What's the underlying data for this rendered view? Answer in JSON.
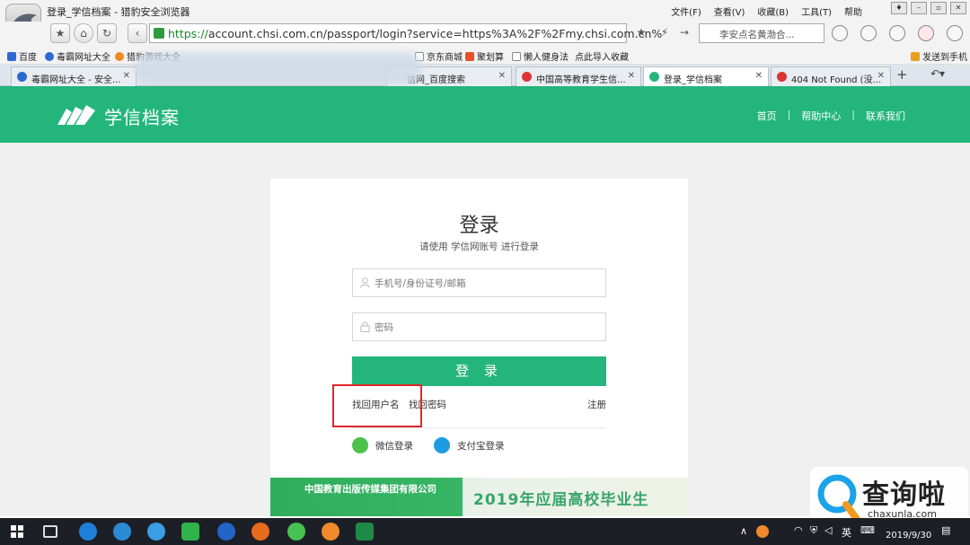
{
  "browser": {
    "window_title": "登录_学信档案 - 猎豹安全浏览器",
    "menu": [
      "文件(F)",
      "查看(V)",
      "收藏(B)",
      "工具(T)",
      "帮助"
    ],
    "url_scheme": "https://",
    "url_rest": "account.chsi.com.cn/passport/login?service=https%3A%2F%2Fmy.chsi.com.cn%",
    "search_placeholder": "李安点名黄渤合...",
    "bookmarks": [
      "百度",
      "毒霸网址大全",
      "猎豹游戏大全",
      "京东商城",
      "聚划算",
      "懒人健身法",
      "点此导入收藏"
    ],
    "send_to_phone": "发送到手机",
    "tabs": [
      {
        "label": "毒霸网址大全 - 安全...",
        "active": false
      },
      {
        "label": "信网_百度搜索",
        "active": false
      },
      {
        "label": "中国高等教育学生信...",
        "active": false
      },
      {
        "label": "登录_学信档案",
        "active": true
      },
      {
        "label": "404 Not Found (没...",
        "active": false
      }
    ],
    "new_tab": "+"
  },
  "site": {
    "name": "学信档案",
    "nav": [
      "首页",
      "帮助中心",
      "联系我们"
    ],
    "nav_sep": "|",
    "accent": "#24b57d"
  },
  "login": {
    "title": "登录",
    "subtitle": "请使用 学信网账号 进行登录",
    "username_placeholder": "手机号/身份证号/邮箱",
    "password_placeholder": "密码",
    "submit": "登 录",
    "find_username": "找回用户名",
    "find_password": "找回密码",
    "register": "注册",
    "wechat": "微信登录",
    "alipay": "支付宝登录"
  },
  "banner": {
    "publisher": "中国教育出版传媒集团有限公司",
    "headline": "2019年应届高校毕业生"
  },
  "watermark": {
    "brand": "查询啦",
    "domain": "chaxunla.com"
  },
  "taskbar": {
    "lang": "英",
    "date": "2019/9/30"
  }
}
